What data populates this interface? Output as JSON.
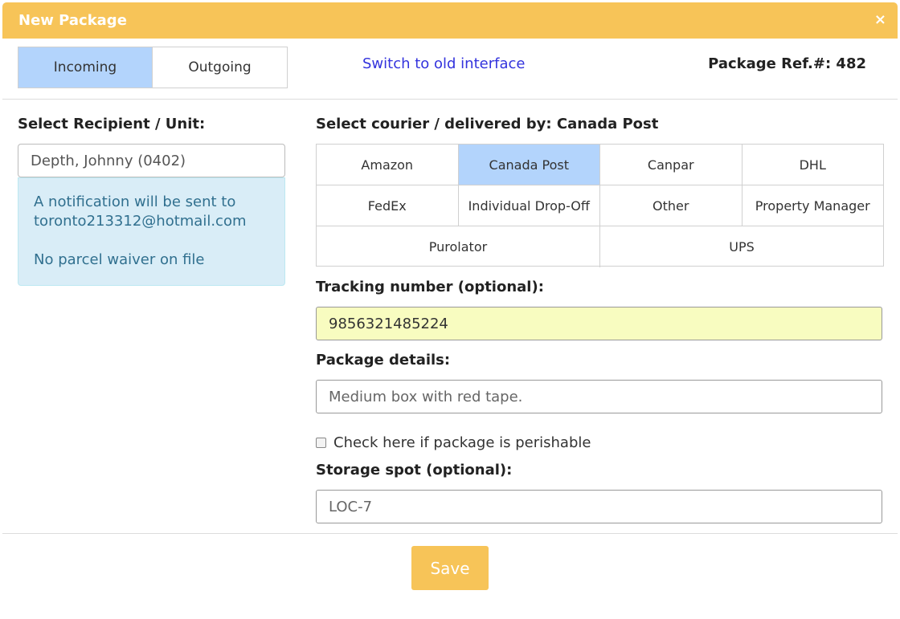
{
  "header": {
    "title": "New Package",
    "close_glyph": "×"
  },
  "tabs": [
    {
      "label": "Incoming",
      "active": true
    },
    {
      "label": "Outgoing",
      "active": false
    }
  ],
  "switch_link": "Switch to old interface",
  "package_ref": "Package Ref.#: 482",
  "recipient": {
    "label": "Select Recipient / Unit:",
    "value": "Depth, Johnny (0402)",
    "notice_line1": "A notification will be sent to",
    "notice_line2": "toronto213312@hotmail.com",
    "waiver": "No parcel waiver on file"
  },
  "courier": {
    "label": "Select courier / delivered by: Canada Post",
    "selected": "Canada Post",
    "rows": [
      [
        "Amazon",
        "Canada Post",
        "Canpar",
        "DHL"
      ],
      [
        "FedEx",
        "Individual Drop-Off",
        "Other",
        "Property Manager"
      ],
      [
        "Purolator",
        "UPS"
      ]
    ]
  },
  "tracking": {
    "label": "Tracking number (optional):",
    "value": "9856321485224"
  },
  "details": {
    "label": "Package details:",
    "placeholder": "Medium box with red tape."
  },
  "perishable": {
    "label": "Check here if package is perishable",
    "checked": false
  },
  "storage": {
    "label": "Storage spot (optional):",
    "placeholder": "LOC-7"
  },
  "save_label": "Save",
  "colors": {
    "accent": "#f7c458",
    "selected": "#b3d4fc",
    "info_bg": "#d9edf7",
    "tracking_bg": "#f8fcc0"
  }
}
